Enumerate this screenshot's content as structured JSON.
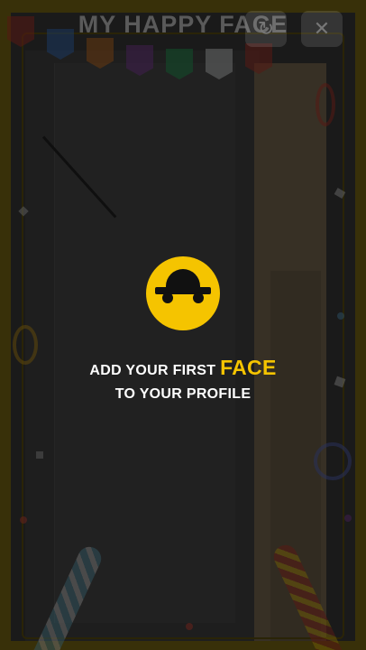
{
  "header": {
    "title": "MY HAPPY FACE",
    "flip_camera_icon": "refresh-icon",
    "close_icon": "close-icon"
  },
  "prompt": {
    "line1_prefix": "ADD YOUR FIRST",
    "highlight": "FACE",
    "line2": "TO YOUR PROFILE"
  },
  "colors": {
    "accent": "#f5c400",
    "frame": "#7d6a14",
    "overlay": "rgba(0,0,0,0.55)"
  }
}
